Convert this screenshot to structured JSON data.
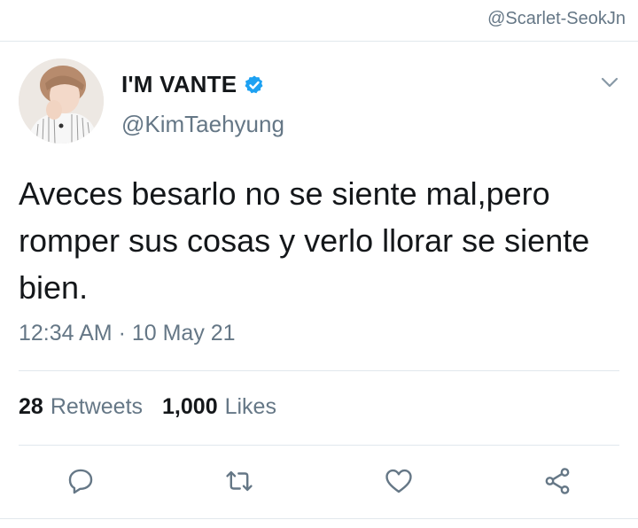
{
  "watermark": "@Scarlet-SeokJn",
  "tweet": {
    "display_name": "I'M VANTE",
    "handle": "@KimTaehyung",
    "text": "Aveces besarlo no se siente mal,pero romper sus cosas y verlo llorar se siente bien.",
    "timestamp": "12:34 AM · 10 May 21",
    "retweets_count": "28",
    "retweets_label": "Retweets",
    "likes_count": "1,000",
    "likes_label": "Likes"
  },
  "icons": {
    "verified": "verified-badge-icon",
    "menu": "chevron-down-icon",
    "reply": "reply-icon",
    "retweet": "retweet-icon",
    "like": "heart-icon",
    "share": "share-icon"
  },
  "colors": {
    "brand_blue": "#1da1f2",
    "secondary_text": "#657786",
    "primary_text": "#14171a",
    "divider": "#e1e8ed"
  }
}
